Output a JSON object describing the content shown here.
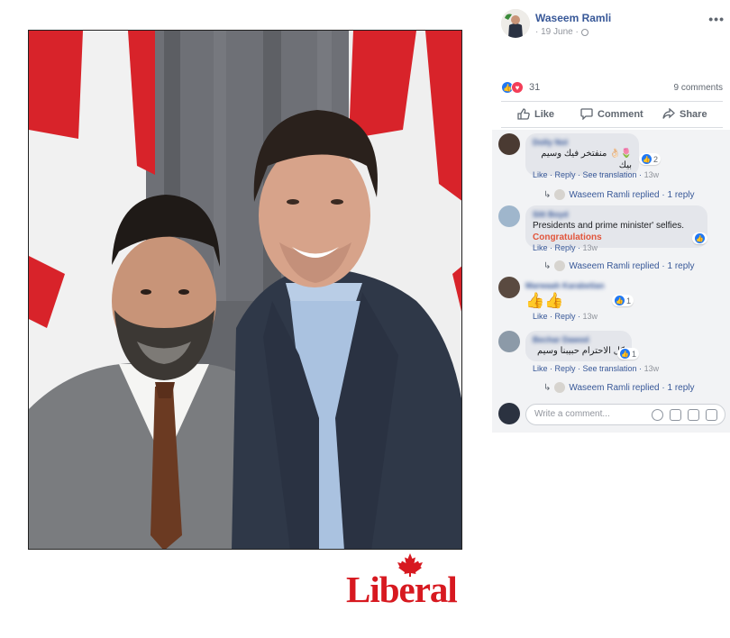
{
  "post": {
    "author": "Waseem Ramli",
    "date": "19 June",
    "more_icon": "more-dots-icon",
    "privacy_icon": "globe-icon"
  },
  "reactions": {
    "count": "31",
    "comments": "9 comments"
  },
  "actions": {
    "like": "Like",
    "comment": "Comment",
    "share": "Share"
  },
  "comments": [
    {
      "name": "Dolly Nol",
      "text": "🌷👌🏻 منفتخر فيك وسيم بيك",
      "reactions": "2",
      "links": "Like · Reply · See translation · ",
      "time": "13w",
      "reply": "Waseem Ramli replied · 1 reply"
    },
    {
      "name": "Sitt Boyd",
      "text": "Presidents and prime minister' selfies. ",
      "highlight": "Congratulations",
      "reactions": "",
      "links": "Like · Reply · ",
      "time": "13w",
      "reply": "Waseem Ramli replied · 1 reply"
    },
    {
      "name": "Marwaah Karabetian",
      "text": "👍👍",
      "reactions": "1",
      "links": "Like · Reply · ",
      "time": "13w",
      "reply": ""
    },
    {
      "name": "Bechar Dawod",
      "text": "كل الاحترام حبيبنا وسيم",
      "reactions": "1",
      "links": "Like · Reply · See translation · ",
      "time": "13w",
      "reply": "Waseem Ramli replied · 1 reply"
    }
  ],
  "composer": {
    "placeholder": "Write a comment..."
  },
  "logo": {
    "text": "Liberal",
    "color": "#d71920"
  },
  "colors": {
    "link": "#385898",
    "like_blue": "#2078f4",
    "love_red": "#f33e58",
    "highlight": "#e2553b"
  }
}
